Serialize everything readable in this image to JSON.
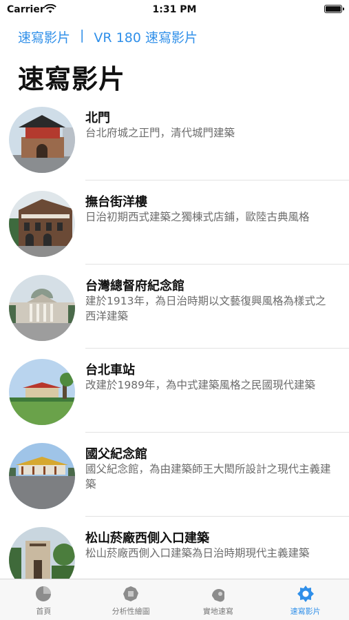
{
  "status": {
    "carrier": "Carrier",
    "time": "1:31 PM"
  },
  "nav": {
    "breadcrumb": [
      "速寫影片",
      "|",
      "VR 180 速寫影片"
    ],
    "title": "速寫影片"
  },
  "items": [
    {
      "name": "北門",
      "desc": "台北府城之正門，清代城門建築"
    },
    {
      "name": "撫台街洋樓",
      "desc": "日治初期西式建築之獨棟式店鋪，歐陸古典風格"
    },
    {
      "name": "台灣總督府紀念館",
      "desc": "建於1913年，為日治時期以文藝復興風格為樣式之西洋建築"
    },
    {
      "name": "台北車站",
      "desc": "改建於1989年，為中式建築風格之民國現代建築"
    },
    {
      "name": "國父紀念館",
      "desc": "國父紀念館，為由建築師王大閎所設計之現代主義建築"
    },
    {
      "name": "松山菸廠西側入口建築",
      "desc": "松山菸廠西側入口建築為日治時期現代主義建築"
    }
  ],
  "tabs": [
    {
      "label": "首頁",
      "icon": "home-icon"
    },
    {
      "label": "分析性繪圖",
      "icon": "analysis-icon"
    },
    {
      "label": "實地速寫",
      "icon": "sketch-icon"
    },
    {
      "label": "速寫影片",
      "icon": "video-icon",
      "active": true
    }
  ],
  "colors": {
    "accent": "#2f8fe9",
    "tab_inactive": "#7a7a7a"
  }
}
